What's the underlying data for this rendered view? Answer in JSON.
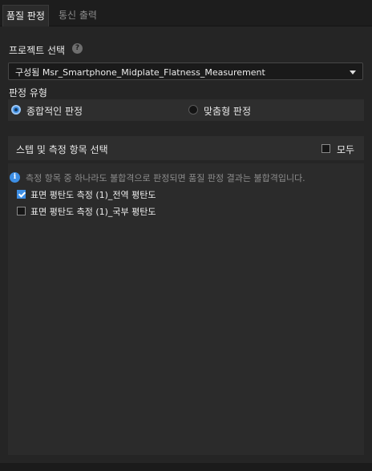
{
  "tabs": [
    {
      "label": "품질 판정",
      "active": true
    },
    {
      "label": "통신 출력",
      "active": false
    }
  ],
  "project": {
    "label": "프로젝트 선택",
    "help_icon": "question-icon",
    "help_glyph": "?",
    "selected": "구성됨 Msr_Smartphone_Midplate_Flatness_Measurement"
  },
  "judgement_type": {
    "label": "판정 유형",
    "options": [
      {
        "label": "종합적인 판정",
        "selected": true
      },
      {
        "label": "맞춤형 판정",
        "selected": false
      }
    ]
  },
  "steps": {
    "header": "스텝 및 측정 항목 선택",
    "select_all_label": "모두",
    "select_all_checked": false,
    "info_icon": "info-icon",
    "info_glyph": "i",
    "info_text": "측정 항목 중 하나라도 불합격으로 판정되면 품질 판정 결과는 불합격입니다.",
    "items": [
      {
        "label": "표면 평탄도 측정 (1)_전역 평탄도",
        "checked": true
      },
      {
        "label": "표면 평탄도 측정 (1)_국부 평탄도",
        "checked": false
      }
    ]
  },
  "colors": {
    "accent": "#3d8ee4",
    "background": "#252525",
    "panel": "#2e2e2e"
  }
}
